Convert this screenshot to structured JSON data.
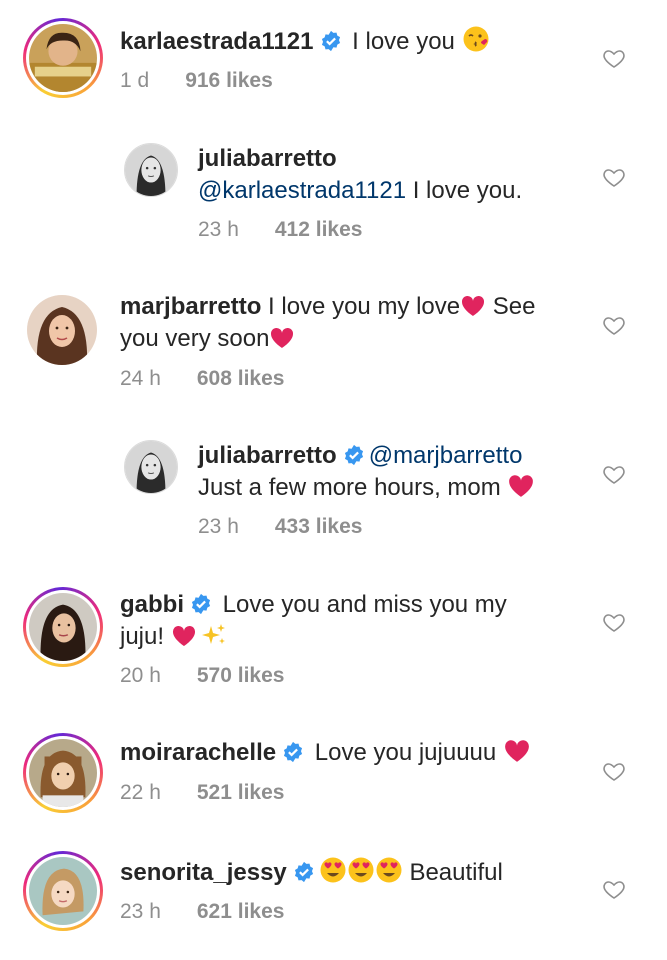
{
  "comments": [
    {
      "username": "karlaestrada1121",
      "verified": true,
      "text": " I love you ",
      "emoji": "kiss-face",
      "time": "1 d",
      "likes": "916 likes"
    },
    {
      "username": "juliabarretto",
      "mention": "@karlaestrada1121",
      "text": " I love you.",
      "time": "23 h",
      "likes": "412 likes"
    },
    {
      "username": "marjbarretto",
      "text_line1": " I love you my love",
      "text_line1b": " See",
      "text_line2": "you very soon",
      "time": "24 h",
      "likes": "608 likes"
    },
    {
      "username": "juliabarretto",
      "verified": true,
      "mention": "@marjbarretto",
      "text_line2": "Just a few more hours, mom ",
      "time": "23 h",
      "likes": "433 likes"
    },
    {
      "username": "gabbi",
      "verified": true,
      "text_line1": " Love you and miss you my",
      "text_line2": "juju! ",
      "time": "20 h",
      "likes": "570 likes"
    },
    {
      "username": "moirarachelle",
      "verified": true,
      "text": " Love you jujuuuu ",
      "time": "22 h",
      "likes": "521 likes"
    },
    {
      "username": "senorita_jessy",
      "verified": true,
      "text": " Beautiful",
      "time": "23 h",
      "likes": "621 likes"
    }
  ],
  "colors": {
    "text": "#262626",
    "meta": "#8e8e8e",
    "mention": "#00376b",
    "verified": "#3897f0",
    "heart": "#e0245e"
  }
}
